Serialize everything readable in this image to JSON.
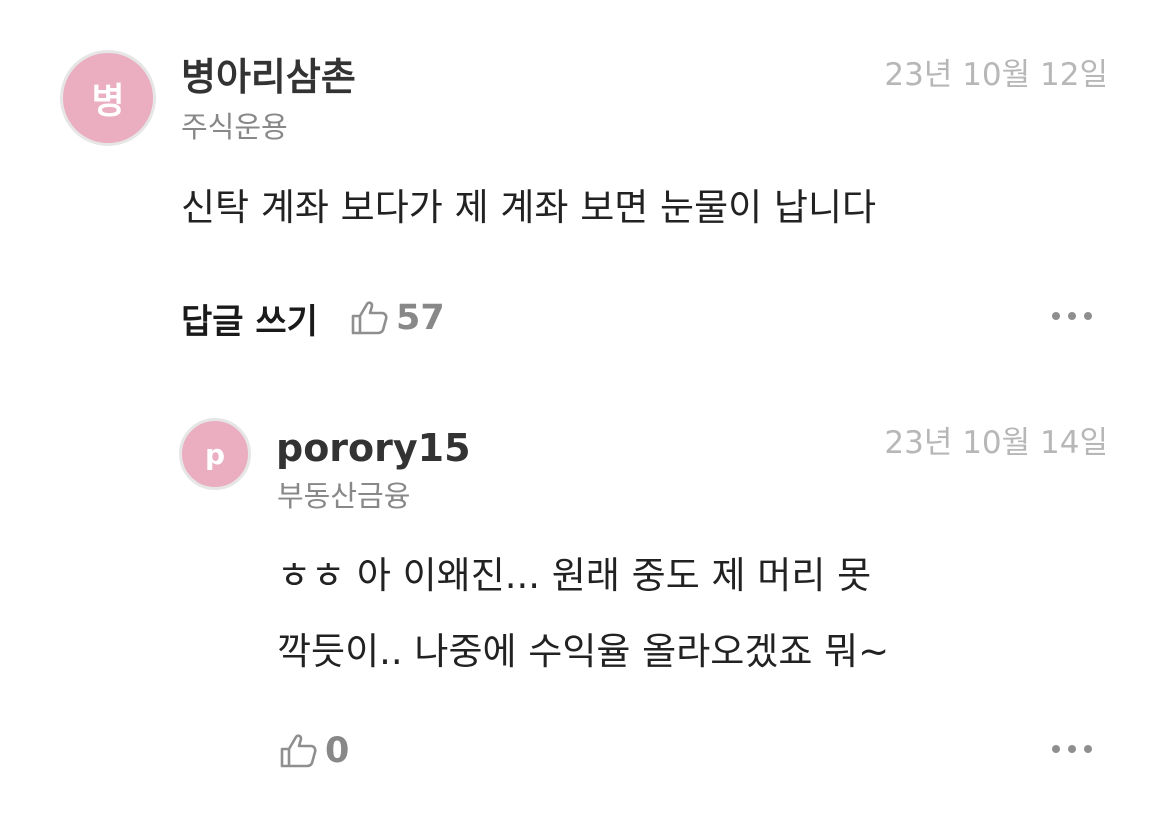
{
  "comments": [
    {
      "avatar_letter": "병",
      "author": "병아리삼촌",
      "subtitle": "주식운용",
      "date": "23년 10월 12일",
      "text_lines": [
        "신탁 계좌 보다가 제 계좌 보면 눈물이 납니다"
      ],
      "reply_label": "답글 쓰기",
      "like_count": "57"
    },
    {
      "avatar_letter": "p",
      "author": "porory15",
      "subtitle": "부동산금융",
      "date": "23년 10월 14일",
      "text_lines": [
        "ㅎㅎ 아 이왜진...  원래 중도 제 머리 못",
        "깍듯이.. 나중에 수익율 올라오겠죠 뭐~"
      ],
      "like_count": "0"
    }
  ],
  "icons": {
    "like": "thumbs-up-icon",
    "more": "more-horizontal-icon"
  },
  "colors": {
    "avatar_bg": "#eaaec0",
    "date_text": "#b7b7b7",
    "secondary_text": "#888888"
  }
}
